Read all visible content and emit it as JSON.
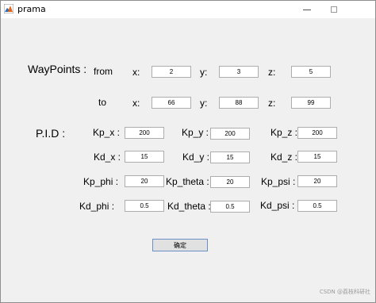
{
  "window": {
    "title": "prama"
  },
  "waypoints": {
    "section_label": "WayPoints :",
    "from_label": "from",
    "to_label": "to",
    "x_label": "x:",
    "y_label": "y:",
    "z_label": "z:",
    "from": {
      "x": "2",
      "y": "3",
      "z": "5"
    },
    "to": {
      "x": "66",
      "y": "88",
      "z": "99"
    }
  },
  "pid": {
    "section_label": "P.I.D :",
    "kp_x": {
      "label": "Kp_x :",
      "value": "200"
    },
    "kp_y": {
      "label": "Kp_y :",
      "value": "200"
    },
    "kp_z": {
      "label": "Kp_z :",
      "value": "200"
    },
    "kd_x": {
      "label": "Kd_x :",
      "value": "15"
    },
    "kd_y": {
      "label": "Kd_y :",
      "value": "15"
    },
    "kd_z": {
      "label": "Kd_z :",
      "value": "15"
    },
    "kp_phi": {
      "label": "Kp_phi :",
      "value": "20"
    },
    "kp_theta": {
      "label": "Kp_theta :",
      "value": "20"
    },
    "kp_psi": {
      "label": "Kp_psi :",
      "value": "20"
    },
    "kd_phi": {
      "label": "Kd_phi :",
      "value": "0.5"
    },
    "kd_theta": {
      "label": "Kd_theta :",
      "value": "0.5"
    },
    "kd_psi": {
      "label": "Kd_psi :",
      "value": "0.5"
    }
  },
  "confirm_button": "确定",
  "watermark": "CSDN @荔枝科研社"
}
